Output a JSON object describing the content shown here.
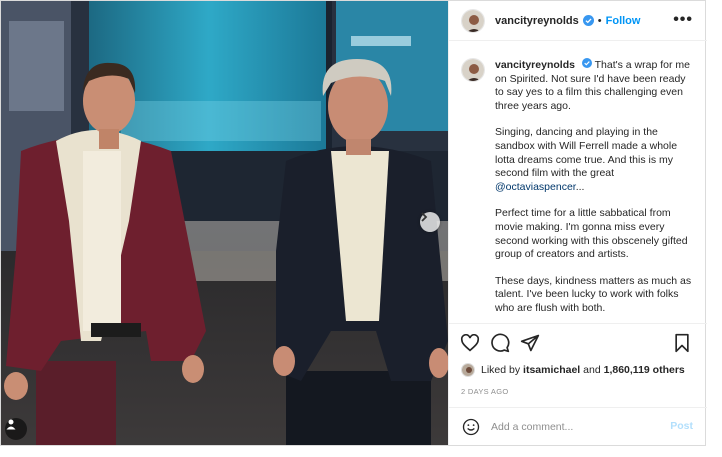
{
  "header": {
    "username": "vancityreynolds",
    "separator": "•",
    "follow_label": "Follow",
    "more_label": "•••"
  },
  "caption": {
    "username": "vancityreynolds",
    "paragraph_1": "That's a wrap for me on Spirited. Not sure I'd have been ready to say yes to a film this challenging even three years ago.",
    "paragraph_2_text": "Singing, dancing and playing in the sandbox with Will Ferrell made a whole lotta dreams come true. And this is my second film with the great",
    "paragraph_2_mention": "@octaviaspencer",
    "paragraph_2_suffix": "...",
    "paragraph_3": "Perfect time for a little sabbatical from movie making. I'm gonna miss every second working with this obscenely gifted group of creators and artists.",
    "paragraph_4": "These days, kindness matters as much as talent. I've been lucky to work with folks who are flush with both."
  },
  "actions": {
    "like_icon": "heart-icon",
    "comment_icon": "comment-bubble-icon",
    "share_icon": "paper-plane-icon",
    "save_icon": "bookmark-icon"
  },
  "likes": {
    "prefix": "Liked by",
    "user": "itsamichael",
    "connector": "and",
    "count": "1,860,119 others"
  },
  "date": "2 DAYS AGO",
  "comment_box": {
    "placeholder": "Add a comment...",
    "post_label": "Post"
  },
  "colors": {
    "accent": "#0095f6",
    "verified": "#3897f0",
    "text": "#262626",
    "muted": "#8e8e8e",
    "post_disabled": "#b2dffc"
  }
}
